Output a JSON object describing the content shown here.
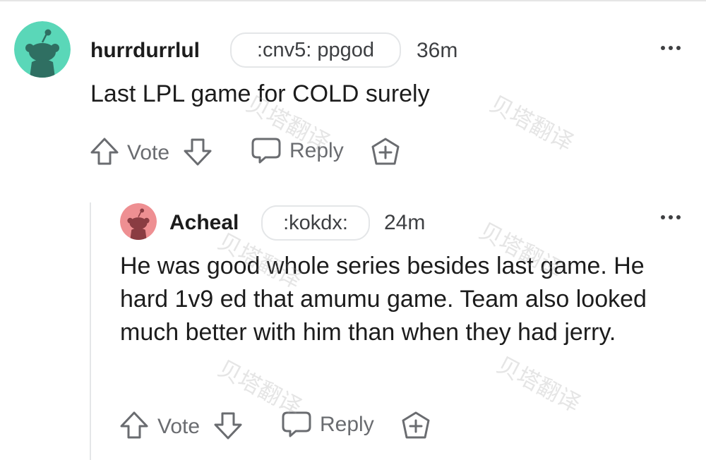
{
  "comments": [
    {
      "username": "hurrdurrlul",
      "flair": ":cnv5: ppgod",
      "time": "36m",
      "body": "Last LPL game for COLD surely",
      "avatar_color": "#5ad7b8",
      "avatar_icon": "snoo-avatar-icon"
    },
    {
      "username": "Acheal",
      "flair": ":kokdx:",
      "time": "24m",
      "body": "He was good whole series besides last game. He hard 1v9 ed that amumu game. Team also looked much better with him than when they had jerry.",
      "avatar_color": "#ee8f92",
      "avatar_icon": "snoo-avatar-icon"
    }
  ],
  "actions": {
    "vote_label": "Vote",
    "reply_label": "Reply",
    "upvote_icon": "upvote-arrow-icon",
    "downvote_icon": "downvote-arrow-icon",
    "reply_icon": "speech-bubble-icon",
    "award_icon": "award-plus-icon",
    "more_icon": "ellipsis-icon"
  },
  "watermark": "贝塔翻译"
}
